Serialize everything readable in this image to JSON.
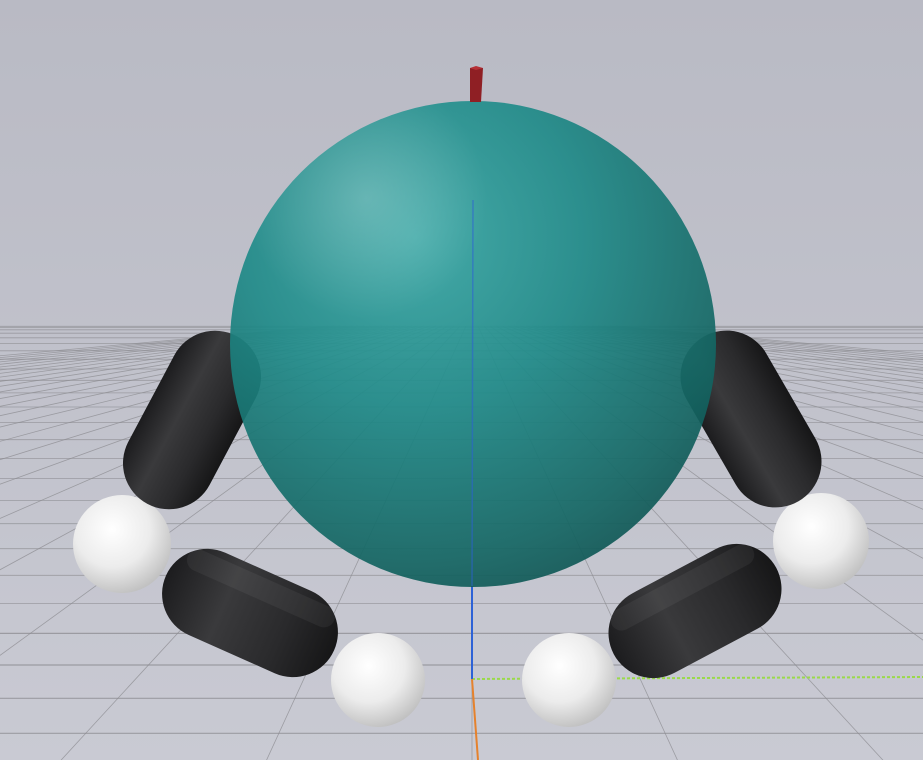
{
  "viewport": {
    "background_top": "#b9bac4",
    "background_bottom": "#c9cad3"
  },
  "ground_grid": {
    "line_color": "#8d8d92",
    "visible": true
  },
  "axes": {
    "x_color": "#9ad94a",
    "y_color": "#e5822d",
    "z_color": "#2d62d6"
  },
  "marker": {
    "color": "#8f1f24"
  },
  "sphere": {
    "color": "#1f8a88",
    "opacity": 0.92
  },
  "capsules": {
    "color": "#2b2b2d",
    "count": 4
  },
  "joint_spheres": {
    "color": "#f1f1f1",
    "count": 4
  }
}
